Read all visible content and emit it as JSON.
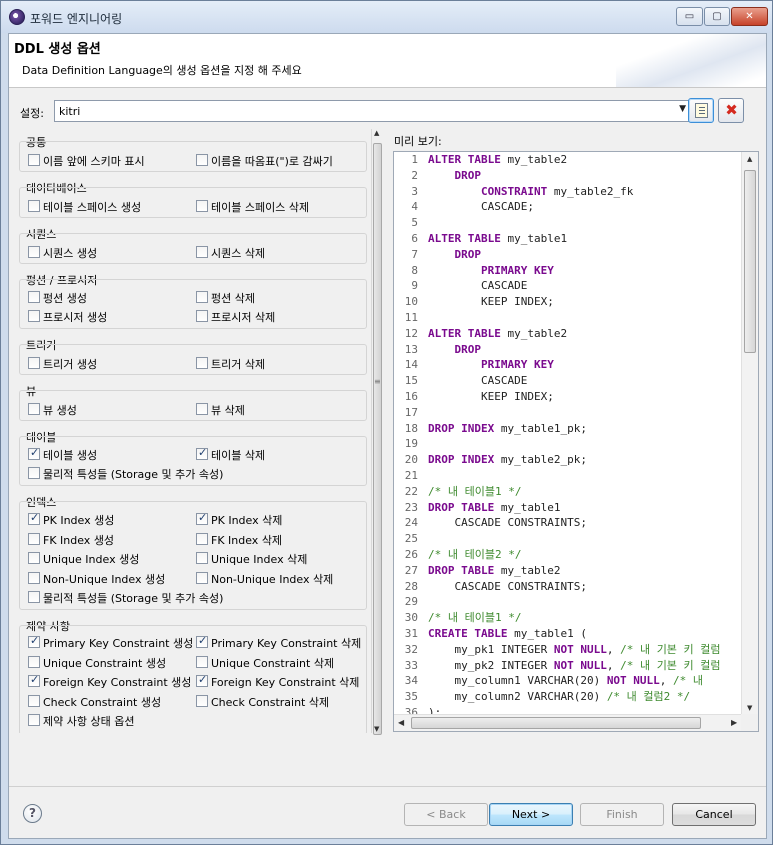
{
  "window": {
    "title": "포워드 엔지니어링",
    "min_glyph": "▭",
    "max_glyph": "▢",
    "close_glyph": "✕"
  },
  "header": {
    "title": "DDL 생성 옵션",
    "description": "Data Definition Language의 생성 옵션을 지정 해 주세요"
  },
  "setting": {
    "label": "설정:",
    "value": "kitri",
    "arrow": "▼",
    "delete_glyph": "✖"
  },
  "groups": {
    "common": {
      "title": "공통",
      "items": [
        {
          "label": "이름 앞에 스키마 표시",
          "checked": false
        },
        {
          "label": "이름을 따옴표(\")로 감싸기",
          "checked": false
        }
      ]
    },
    "database": {
      "title": "데이타베이스",
      "items": [
        {
          "label": "테이블 스페이스 생성",
          "checked": false
        },
        {
          "label": "테이블 스페이스 삭제",
          "checked": false
        }
      ]
    },
    "sequence": {
      "title": "시퀀스",
      "items": [
        {
          "label": "시퀀스 생성",
          "checked": false
        },
        {
          "label": "시퀀스 삭제",
          "checked": false
        }
      ]
    },
    "function": {
      "title": "펑션 / 프로시저",
      "items": [
        {
          "label": "펑션 생성",
          "checked": false
        },
        {
          "label": "펑션 삭제",
          "checked": false
        },
        {
          "label": "프로시저 생성",
          "checked": false
        },
        {
          "label": "프로시저 삭제",
          "checked": false
        }
      ]
    },
    "trigger": {
      "title": "트리거",
      "items": [
        {
          "label": "트리거 생성",
          "checked": false
        },
        {
          "label": "트리거 삭제",
          "checked": false
        }
      ]
    },
    "view": {
      "title": "뷰",
      "items": [
        {
          "label": "뷰 생성",
          "checked": false
        },
        {
          "label": "뷰 삭제",
          "checked": false
        }
      ]
    },
    "table": {
      "title": "테이블",
      "items": [
        {
          "label": "테이블 생성",
          "checked": true
        },
        {
          "label": "테이블 삭제",
          "checked": true
        },
        {
          "label": "물리적 특성들 (Storage 및 추가 속성)",
          "checked": false
        }
      ]
    },
    "index": {
      "title": "인덱스",
      "items": [
        {
          "label": "PK Index 생성",
          "checked": true
        },
        {
          "label": "PK Index 삭제",
          "checked": true
        },
        {
          "label": "FK Index 생성",
          "checked": false
        },
        {
          "label": "FK Index 삭제",
          "checked": false
        },
        {
          "label": "Unique Index 생성",
          "checked": false
        },
        {
          "label": "Unique Index 삭제",
          "checked": false
        },
        {
          "label": "Non-Unique Index 생성",
          "checked": false
        },
        {
          "label": "Non-Unique Index 삭제",
          "checked": false
        },
        {
          "label": "물리적 특성들 (Storage 및 추가 속성)",
          "checked": false
        }
      ]
    },
    "constraint": {
      "title": "제약 사항",
      "items": [
        {
          "label": "Primary Key Constraint 생성",
          "checked": true
        },
        {
          "label": "Primary Key Constraint 삭제",
          "checked": true
        },
        {
          "label": "Unique Constraint 생성",
          "checked": false
        },
        {
          "label": "Unique Constraint 삭제",
          "checked": false
        },
        {
          "label": "Foreign Key Constraint 생성",
          "checked": true
        },
        {
          "label": "Foreign Key Constraint 삭제",
          "checked": true
        },
        {
          "label": "Check Constraint 생성",
          "checked": false
        },
        {
          "label": "Check Constraint 삭제",
          "checked": false
        },
        {
          "label": "제약 사항 상태 옵션",
          "checked": false
        }
      ]
    }
  },
  "preview": {
    "label": "미리 보기:",
    "lines": [
      {
        "n": "1",
        "parts": [
          {
            "t": "kw",
            "v": "ALTER TABLE"
          },
          {
            "t": "pl",
            "v": " my_table2"
          }
        ]
      },
      {
        "n": "2",
        "parts": [
          {
            "t": "pl",
            "v": "    "
          },
          {
            "t": "kw",
            "v": "DROP"
          }
        ]
      },
      {
        "n": "3",
        "parts": [
          {
            "t": "pl",
            "v": "        "
          },
          {
            "t": "kw",
            "v": "CONSTRAINT"
          },
          {
            "t": "pl",
            "v": " my_table2_fk"
          }
        ]
      },
      {
        "n": "4",
        "parts": [
          {
            "t": "pl",
            "v": "        CASCADE;"
          }
        ]
      },
      {
        "n": "5",
        "parts": []
      },
      {
        "n": "6",
        "parts": [
          {
            "t": "kw",
            "v": "ALTER TABLE"
          },
          {
            "t": "pl",
            "v": " my_table1"
          }
        ]
      },
      {
        "n": "7",
        "parts": [
          {
            "t": "pl",
            "v": "    "
          },
          {
            "t": "kw",
            "v": "DROP"
          }
        ]
      },
      {
        "n": "8",
        "parts": [
          {
            "t": "pl",
            "v": "        "
          },
          {
            "t": "kw",
            "v": "PRIMARY KEY"
          }
        ]
      },
      {
        "n": "9",
        "parts": [
          {
            "t": "pl",
            "v": "        CASCADE"
          }
        ]
      },
      {
        "n": "10",
        "parts": [
          {
            "t": "pl",
            "v": "        KEEP INDEX;"
          }
        ]
      },
      {
        "n": "11",
        "parts": []
      },
      {
        "n": "12",
        "parts": [
          {
            "t": "kw",
            "v": "ALTER TABLE"
          },
          {
            "t": "pl",
            "v": " my_table2"
          }
        ]
      },
      {
        "n": "13",
        "parts": [
          {
            "t": "pl",
            "v": "    "
          },
          {
            "t": "kw",
            "v": "DROP"
          }
        ]
      },
      {
        "n": "14",
        "parts": [
          {
            "t": "pl",
            "v": "        "
          },
          {
            "t": "kw",
            "v": "PRIMARY KEY"
          }
        ]
      },
      {
        "n": "15",
        "parts": [
          {
            "t": "pl",
            "v": "        CASCADE"
          }
        ]
      },
      {
        "n": "16",
        "parts": [
          {
            "t": "pl",
            "v": "        KEEP INDEX;"
          }
        ]
      },
      {
        "n": "17",
        "parts": []
      },
      {
        "n": "18",
        "parts": [
          {
            "t": "kw",
            "v": "DROP INDEX"
          },
          {
            "t": "pl",
            "v": " my_table1_pk;"
          }
        ]
      },
      {
        "n": "19",
        "parts": []
      },
      {
        "n": "20",
        "parts": [
          {
            "t": "kw",
            "v": "DROP INDEX"
          },
          {
            "t": "pl",
            "v": " my_table2_pk;"
          }
        ]
      },
      {
        "n": "21",
        "parts": []
      },
      {
        "n": "22",
        "parts": [
          {
            "t": "cm",
            "v": "/* 내 테이블1 */"
          }
        ]
      },
      {
        "n": "23",
        "parts": [
          {
            "t": "kw",
            "v": "DROP TABLE"
          },
          {
            "t": "pl",
            "v": " my_table1"
          }
        ]
      },
      {
        "n": "24",
        "parts": [
          {
            "t": "pl",
            "v": "    CASCADE CONSTRAINTS;"
          }
        ]
      },
      {
        "n": "25",
        "parts": []
      },
      {
        "n": "26",
        "parts": [
          {
            "t": "cm",
            "v": "/* 내 테이블2 */"
          }
        ]
      },
      {
        "n": "27",
        "parts": [
          {
            "t": "kw",
            "v": "DROP TABLE"
          },
          {
            "t": "pl",
            "v": " my_table2"
          }
        ]
      },
      {
        "n": "28",
        "parts": [
          {
            "t": "pl",
            "v": "    CASCADE CONSTRAINTS;"
          }
        ]
      },
      {
        "n": "29",
        "parts": []
      },
      {
        "n": "30",
        "parts": [
          {
            "t": "cm",
            "v": "/* 내 테이블1 */"
          }
        ]
      },
      {
        "n": "31",
        "parts": [
          {
            "t": "kw",
            "v": "CREATE TABLE"
          },
          {
            "t": "pl",
            "v": " my_table1 ("
          }
        ]
      },
      {
        "n": "32",
        "parts": [
          {
            "t": "pl",
            "v": "    my_pk1 INTEGER "
          },
          {
            "t": "kw",
            "v": "NOT NULL"
          },
          {
            "t": "pl",
            "v": ", "
          },
          {
            "t": "cm",
            "v": "/* 내 기본 키 컬럼"
          }
        ]
      },
      {
        "n": "33",
        "parts": [
          {
            "t": "pl",
            "v": "    my_pk2 INTEGER "
          },
          {
            "t": "kw",
            "v": "NOT NULL"
          },
          {
            "t": "pl",
            "v": ", "
          },
          {
            "t": "cm",
            "v": "/* 내 기본 키 컬럼"
          }
        ]
      },
      {
        "n": "34",
        "parts": [
          {
            "t": "pl",
            "v": "    my_column1 VARCHAR(20) "
          },
          {
            "t": "kw",
            "v": "NOT NULL"
          },
          {
            "t": "pl",
            "v": ", "
          },
          {
            "t": "cm",
            "v": "/* 내"
          }
        ]
      },
      {
        "n": "35",
        "parts": [
          {
            "t": "pl",
            "v": "    my_column2 VARCHAR(20) "
          },
          {
            "t": "cm",
            "v": "/* 내 컬럼2 */"
          }
        ]
      },
      {
        "n": "36",
        "parts": [
          {
            "t": "pl",
            "v": ");"
          }
        ]
      }
    ]
  },
  "footer": {
    "help_glyph": "?",
    "back_label": "< Back",
    "next_label": "Next >",
    "finish_label": "Finish",
    "cancel_label": "Cancel"
  }
}
